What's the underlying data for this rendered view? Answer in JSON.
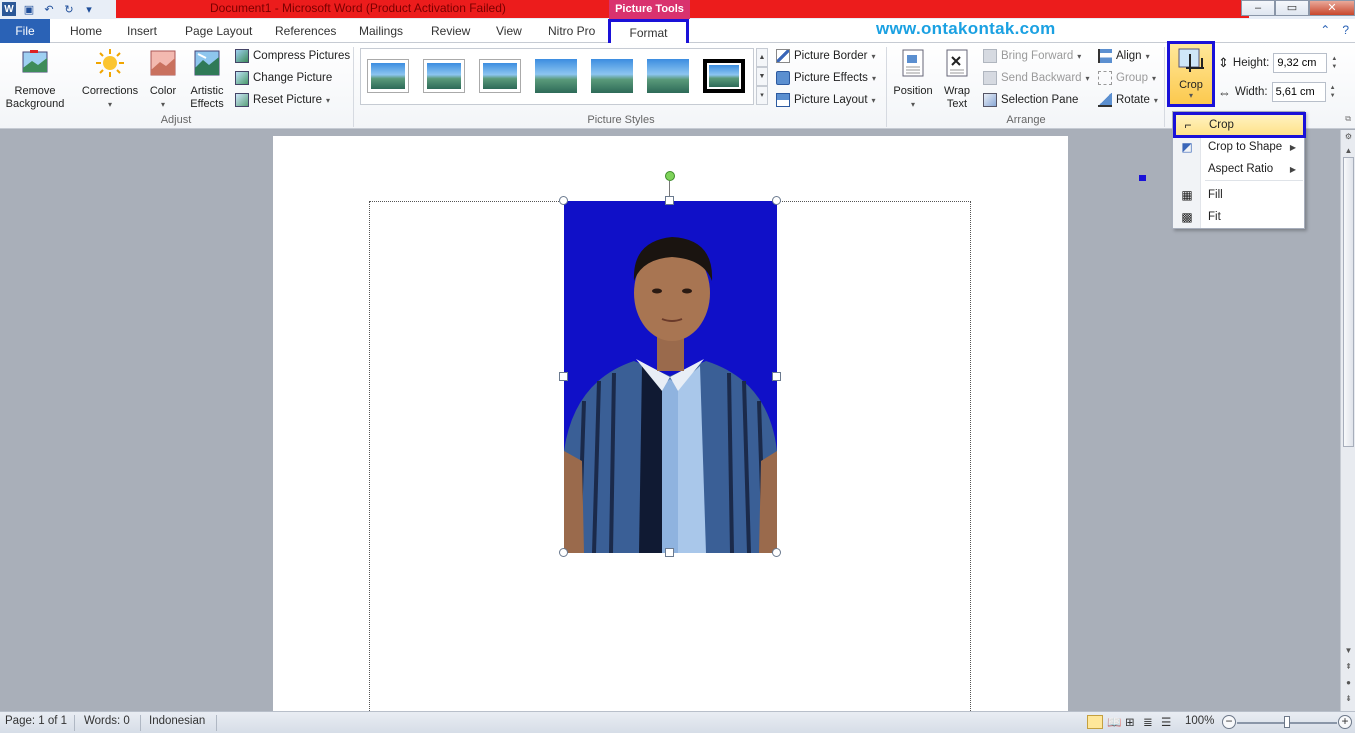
{
  "title": {
    "document": "Document1  -  Microsoft Word (Product Activation Failed)",
    "context_tab_group": "Picture Tools"
  },
  "tabs": {
    "file": "File",
    "items": [
      "Home",
      "Insert",
      "Page Layout",
      "References",
      "Mailings",
      "Review",
      "View",
      "Nitro Pro"
    ],
    "format": "Format"
  },
  "watermark_site": "www.ontakontak.com",
  "ribbon": {
    "adjust": {
      "remove_background": "Remove\nBackground",
      "corrections": "Corrections",
      "color": "Color",
      "artistic_effects": "Artistic\nEffects",
      "compress": "Compress Pictures",
      "change": "Change Picture",
      "reset": "Reset Picture",
      "label": "Adjust"
    },
    "styles": {
      "border": "Picture Border",
      "effects": "Picture Effects",
      "layout": "Picture Layout",
      "label": "Picture Styles"
    },
    "arrange": {
      "position": "Position",
      "wrap": "Wrap\nText",
      "bring_forward": "Bring Forward",
      "send_backward": "Send Backward",
      "selection_pane": "Selection Pane",
      "align": "Align",
      "group": "Group",
      "rotate": "Rotate",
      "label": "Arrange"
    },
    "size": {
      "crop": "Crop",
      "height_label": "Height:",
      "height_value": "9,32 cm",
      "width_label": "Width:",
      "width_value": "5,61 cm"
    }
  },
  "crop_menu": {
    "items": [
      {
        "label": "Crop",
        "has_sub": false
      },
      {
        "label": "Crop to Shape",
        "has_sub": true
      },
      {
        "label": "Aspect Ratio",
        "has_sub": true
      },
      {
        "label": "Fill",
        "has_sub": false
      },
      {
        "label": "Fit",
        "has_sub": false
      }
    ]
  },
  "status": {
    "page": "Page: 1 of 1",
    "words": "Words: 0",
    "language": "Indonesian",
    "zoom": "100%"
  },
  "colors": {
    "highlight_border": "#1a11d8",
    "photo_background": "#1010c8",
    "title_red": "#ec1c1c",
    "file_tab": "#2a62b6",
    "picture_tools": "#d9326e"
  }
}
